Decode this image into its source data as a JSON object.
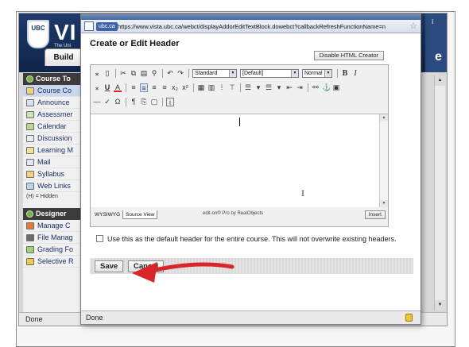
{
  "background_app": {
    "logo_text": "UBC",
    "brand": "VI",
    "brand_sub": "The Uni",
    "right_letters": "e",
    "right_top_text": "i",
    "tabs": {
      "build": "Build"
    },
    "course_tools_header": "Course To",
    "course_tools": [
      {
        "label": "Course Co",
        "selected": true
      },
      {
        "label": "Announce",
        "selected": false
      },
      {
        "label": "Assessmer",
        "selected": false
      },
      {
        "label": "Calendar",
        "selected": false
      },
      {
        "label": "Discussion",
        "selected": false
      },
      {
        "label": "Learning M",
        "selected": false
      },
      {
        "label": "Mail",
        "selected": false
      },
      {
        "label": "Syllabus",
        "selected": false
      },
      {
        "label": "Web Links",
        "selected": false
      }
    ],
    "hidden_note": "(H) = Hidden",
    "designer_header": "Designer",
    "designer_tools": [
      {
        "label": "Manage C"
      },
      {
        "label": "File Manag"
      },
      {
        "label": "Grading Fo"
      },
      {
        "label": "Selective R"
      }
    ],
    "status": "Done"
  },
  "popup": {
    "site_badge": "ubc.ca",
    "url": "https://www.vista.ubc.ca/webct/displayAddorEditTextBlock.dowebct?callbackRefreshFunctionName=n",
    "title": "Create or Edit Header",
    "disable_html_button": "Disable HTML Creator",
    "toolbar": {
      "style_select": "Standard",
      "font_select": "[Default]",
      "size_select": "Normal",
      "bold": "B",
      "italic": "I",
      "underline": "U"
    },
    "mode_tabs": [
      "WYSIWYG",
      "Source View"
    ],
    "active_mode": "Source View",
    "powered_by": "edit-on® Pro by RealObjects",
    "insert_button": "Insert",
    "checkbox_label": "Use this as the default header for the entire course. This will not overwrite existing headers.",
    "checkbox_checked": false,
    "save_button": "Save",
    "cancel_button": "Cancel",
    "status": "Done"
  },
  "colors": {
    "annotation_arrow": "#d8262b",
    "header_bg": "#1e3a6c"
  }
}
